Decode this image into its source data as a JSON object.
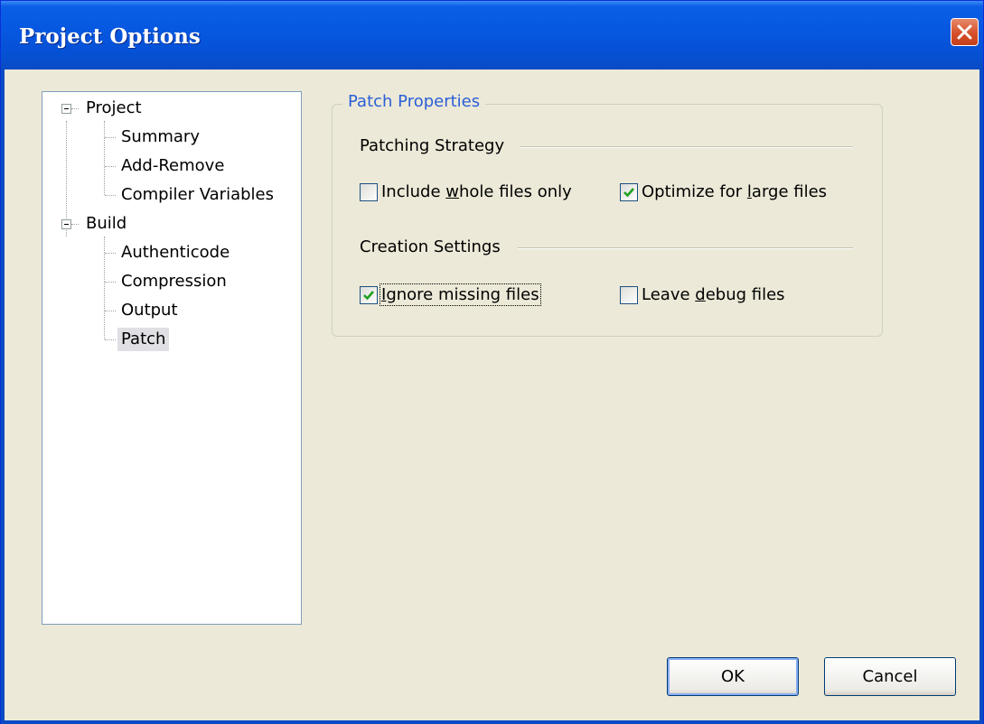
{
  "window": {
    "title": "Project Options"
  },
  "tree": {
    "groups": [
      {
        "label": "Project",
        "children": [
          "Summary",
          "Add-Remove",
          "Compiler Variables"
        ]
      },
      {
        "label": "Build",
        "children": [
          "Authenticode",
          "Compression",
          "Output",
          "Patch"
        ]
      }
    ],
    "selected": "Patch"
  },
  "patch_properties": {
    "title": "Patch Properties",
    "patching_strategy": {
      "label": "Patching Strategy",
      "include_whole_files": {
        "pre": "Include ",
        "mnemonic": "w",
        "post": "hole files only",
        "checked": false
      },
      "optimize_large_files": {
        "pre": "Optimize for ",
        "mnemonic": "l",
        "post": "arge files",
        "checked": true
      }
    },
    "creation_settings": {
      "label": "Creation Settings",
      "ignore_missing_files": {
        "pre": "",
        "mnemonic": "I",
        "post": "gnore missing files",
        "checked": true
      },
      "leave_debug_files": {
        "pre": "Leave ",
        "mnemonic": "d",
        "post": "ebug files",
        "checked": false
      }
    }
  },
  "buttons": {
    "ok": "OK",
    "cancel": "Cancel"
  },
  "colors": {
    "titlebar": "#0758e1",
    "group_title": "#2b5fd6",
    "face": "#ece9d8"
  }
}
